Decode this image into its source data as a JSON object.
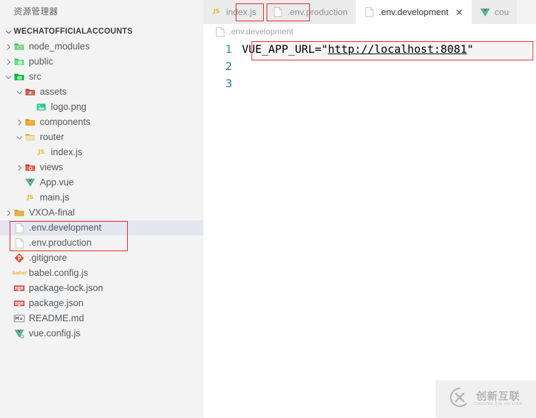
{
  "sidebar": {
    "title": "资源管理器",
    "section": {
      "label": "WECHATOFFICIALACCOUNTS",
      "twisty": "chevron-down-icon"
    },
    "items": [
      {
        "label": "node_modules",
        "icon": "folder-node-modules-icon",
        "indent": 1,
        "twisty": "chevron-right-icon",
        "selected": false
      },
      {
        "label": "public",
        "icon": "folder-public-icon",
        "indent": 1,
        "twisty": "chevron-right-icon",
        "selected": false
      },
      {
        "label": "src",
        "icon": "folder-src-icon",
        "indent": 1,
        "twisty": "chevron-down-icon",
        "selected": false
      },
      {
        "label": "assets",
        "icon": "folder-assets-icon",
        "indent": 2,
        "twisty": "chevron-down-icon",
        "selected": false
      },
      {
        "label": "logo.png",
        "icon": "image-file-icon",
        "indent": 3,
        "twisty": "none",
        "selected": false
      },
      {
        "label": "components",
        "icon": "folder-components-icon",
        "indent": 2,
        "twisty": "chevron-right-icon",
        "selected": false
      },
      {
        "label": "router",
        "icon": "folder-router-icon",
        "indent": 2,
        "twisty": "chevron-down-icon",
        "selected": false
      },
      {
        "label": "index.js",
        "icon": "js-file-icon",
        "indent": 3,
        "twisty": "none",
        "selected": false
      },
      {
        "label": "views",
        "icon": "folder-views-icon",
        "indent": 2,
        "twisty": "chevron-right-icon",
        "selected": false
      },
      {
        "label": "App.vue",
        "icon": "vue-file-icon",
        "indent": 2,
        "twisty": "none",
        "selected": false
      },
      {
        "label": "main.js",
        "icon": "js-file-icon",
        "indent": 2,
        "twisty": "none",
        "selected": false
      },
      {
        "label": "VXOA-final",
        "icon": "folder-generic-icon",
        "indent": 1,
        "twisty": "chevron-right-icon",
        "selected": false
      },
      {
        "label": ".env.development",
        "icon": "text-file-icon",
        "indent": 1,
        "twisty": "none",
        "selected": true
      },
      {
        "label": ".env.production",
        "icon": "text-file-icon",
        "indent": 1,
        "twisty": "none",
        "selected": false
      },
      {
        "label": ".gitignore",
        "icon": "git-file-icon",
        "indent": 1,
        "twisty": "none",
        "selected": false
      },
      {
        "label": "babel.config.js",
        "icon": "babel-file-icon",
        "indent": 1,
        "twisty": "none",
        "selected": false
      },
      {
        "label": "package-lock.json",
        "icon": "npm-file-icon",
        "indent": 1,
        "twisty": "none",
        "selected": false
      },
      {
        "label": "package.json",
        "icon": "npm-file-icon",
        "indent": 1,
        "twisty": "none",
        "selected": false
      },
      {
        "label": "README.md",
        "icon": "markdown-file-icon",
        "indent": 1,
        "twisty": "none",
        "selected": false
      },
      {
        "label": "vue.config.js",
        "icon": "vue-config-file-icon",
        "indent": 1,
        "twisty": "none",
        "selected": false
      }
    ]
  },
  "tabs": [
    {
      "label": "index.js",
      "icon": "js-file-icon",
      "active": false,
      "closable": false
    },
    {
      "label": ".env.production",
      "icon": "text-file-icon",
      "active": false,
      "closable": false
    },
    {
      "label": ".env.development",
      "icon": "text-file-icon",
      "active": true,
      "closable": true,
      "close_glyph": "✕"
    },
    {
      "label": "cou",
      "icon": "vue-file-icon",
      "active": false,
      "closable": false
    }
  ],
  "breadcrumb": {
    "label": ".env.development",
    "icon": "text-file-icon"
  },
  "editor": {
    "lines": [
      {
        "number": "1",
        "text": "VUE_APP_URL=\"",
        "url": "http://localhost:8081",
        "suffix": "\""
      },
      {
        "number": "2",
        "text": "",
        "url": "",
        "suffix": ""
      },
      {
        "number": "3",
        "text": "",
        "url": "",
        "suffix": ""
      }
    ]
  },
  "watermark": {
    "cn": "创新互联",
    "en": "CHUANG XIN HU LIAN",
    "logo": "cx-logo-icon"
  },
  "colors": {
    "annotation": "#e8231f",
    "selection": "#e4e6f1",
    "sidebar_bg": "#f3f3f3",
    "line_number": "#2b91af",
    "tab_inactive_bg": "#ececec"
  }
}
